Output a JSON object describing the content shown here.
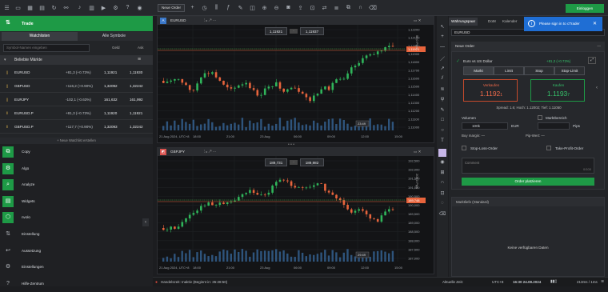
{
  "toolbar": {
    "new_order": "Neue Order",
    "login": "Einloggen"
  },
  "left": {
    "title": "Trade",
    "tabs": [
      "Watchlisten",
      "Alle Symbole"
    ],
    "search_placeholder": "Symbol-Namen eingeben",
    "col_bid": "Geld",
    "col_ask": "Ask",
    "favorites_title": "Beliebte Märkte",
    "rows": [
      {
        "symbol": "EURUSD",
        "change": "+81,3 (+0.73%)",
        "bid": "1,11921",
        "ask": "1,11930"
      },
      {
        "symbol": "GBPUSD",
        "change": "+116,2 (+0.90%)",
        "bid": "1,32092",
        "ask": "1,32242"
      },
      {
        "symbol": "EURJPY",
        "change": "-102,1 (-0.63%)",
        "bid": "161,632",
        "ask": "161,992"
      },
      {
        "symbol": "EURUSD.P",
        "change": "+81,3 (+0.73%)",
        "bid": "1,11920",
        "ask": "1,11921"
      },
      {
        "symbol": "GBPUSD.P",
        "change": "+117,7 (+0.90%)",
        "bid": "1,32093",
        "ask": "1,32242"
      }
    ],
    "add_watchlist": "+ Neue Watchlist erstellen"
  },
  "menu": {
    "items": [
      "Copy",
      "Algo",
      "Analyze",
      "Widgets",
      "nvolo",
      "Einstellung",
      "Aussetzung",
      "Einstellungen",
      "Hilfe-Zentrum"
    ]
  },
  "chart1": {
    "symbol": "EURUSD",
    "sell": "1,11921",
    "buy": "1,11937",
    "price_labels": [
      "1,12200",
      "1,12100",
      "1,12000",
      "1,11900",
      "1,11800",
      "1,11700",
      "1,11600",
      "1,11500",
      "1,11400",
      "1,11300",
      "1,11200",
      "1,11100",
      "1,11000"
    ],
    "current": "1,11921",
    "pips": "50,0 Pips",
    "time_labels": [
      "21 Aug 2024, UTC+8",
      "18:00",
      "21:00",
      "23 Aug",
      "06:00",
      "09:00",
      "12:00",
      "15:00"
    ],
    "countdown": "23:49",
    "chart_data": {
      "type": "candlestick",
      "title": "EURUSD"
    }
  },
  "chart2": {
    "symbol": "GBPJPY",
    "sell": "189,731",
    "buy": "189,982",
    "price_labels": [
      "192,500",
      "192,000",
      "191,500",
      "191,000",
      "190,500",
      "190,000",
      "189,500",
      "189,000",
      "188,500",
      "188,000",
      "187,500",
      "187,000"
    ],
    "current": "189,748",
    "pips": "200,0 Pips",
    "time_labels": [
      "21 Aug 2024, UTC+8",
      "18:00",
      "21:00",
      "23 Aug",
      "06:00",
      "09:00",
      "12:00",
      "15:00"
    ],
    "countdown": "29:49",
    "chart_data": {
      "type": "candlestick",
      "title": "GBPJPY"
    }
  },
  "right": {
    "tabs": [
      "Währungspaar",
      "DoM",
      "Kalender"
    ],
    "symbol": "EURUSD",
    "order_title": "Neue Order",
    "pair_name": "Euro vs US Dollar",
    "pair_change": "+81,3 (+0.73%)",
    "order_types": [
      "Markt",
      "Limit",
      "Stop",
      "Stop-Limit"
    ],
    "sell_label": "Verkaufen",
    "sell_price": "1.1192",
    "sell_sup": "1",
    "buy_label": "Kaufen",
    "buy_price": "1.1193",
    "buy_sup": "7",
    "spread": "Spread: 1.6; Hoch: 1.12002; Tief: 1.11050",
    "volume_label": "Volumen",
    "volume_value": "100k",
    "currency": "EUR",
    "market_range": "Marktbereich",
    "pips_label": "Pips",
    "buy_margin": "Buy margin: —",
    "pip_value": "Pip-Wert: —",
    "stop_loss": "Stop-Loss-Order",
    "take_profit": "Take-Profit-Order",
    "comment_label": "Comment",
    "comment_count": "0/100",
    "place_order": "Order platzieren",
    "watchlist_title": "Marktliefe (Standard)",
    "no_data": "Keine verfügbaren Daten",
    "notice": "Please sign in to cTrader"
  },
  "status": {
    "text": "Handelszeit: Inaktiv (Beginnt in: 35:28:50)",
    "time_label": "Aktuelle Zeit:",
    "tz": "UTC+8",
    "time": "16:30 24.08.2024",
    "latency": "213ms / 1ms"
  }
}
